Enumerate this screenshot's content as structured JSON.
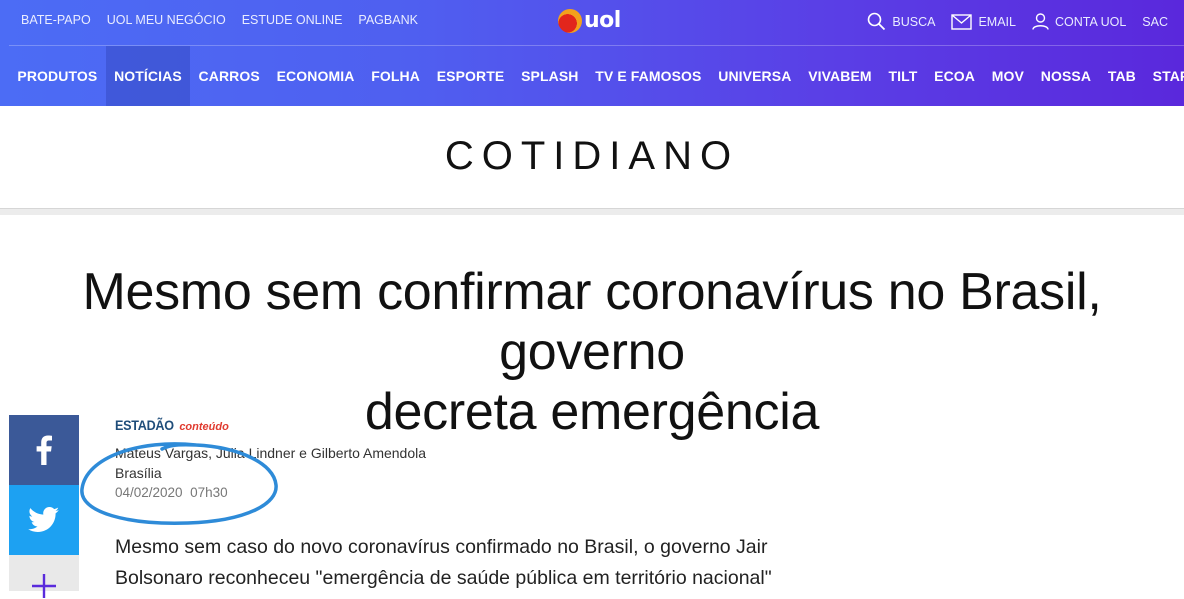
{
  "header": {
    "top_links": [
      "BATE-PAPO",
      "UOL MEU NEGÓCIO",
      "ESTUDE ONLINE",
      "PAGBANK"
    ],
    "logo_text": "uol",
    "right_links": {
      "search": "BUSCA",
      "email": "EMAIL",
      "account": "CONTA UOL",
      "sac": "SAC"
    },
    "nav": [
      "PRODUTOS",
      "NOTÍCIAS",
      "CARROS",
      "ECONOMIA",
      "FOLHA",
      "ESPORTE",
      "SPLASH",
      "TV E FAMOSOS",
      "UNIVERSA",
      "VIVABEM",
      "TILT",
      "ECOA",
      "MOV",
      "NOSSA",
      "TAB",
      "START"
    ],
    "active_nav": "NOTÍCIAS"
  },
  "section": {
    "title": "COTIDIANO"
  },
  "article": {
    "headline_line1": "Mesmo sem confirmar coronavírus no Brasil, governo",
    "headline_line2": "decreta emergência",
    "source_main": "ESTADÃO",
    "source_sub": "conteúdo",
    "authors": "Mateus Vargas, Julia Lindner e Gilberto Amendola",
    "place": "Brasília",
    "date": "04/02/2020",
    "time": "07h30",
    "body_line1": "Mesmo sem caso do novo coronavírus confirmado no Brasil, o governo Jair",
    "body_line2": "Bolsonaro reconheceu \"emergência de saúde pública em território nacional\""
  },
  "share": {
    "icons": [
      "facebook-icon",
      "twitter-icon",
      "plus-icon"
    ]
  },
  "colors": {
    "header_start": "#4c6cf5",
    "header_end": "#5a28dc",
    "facebook": "#3b5998",
    "twitter": "#1da1f2",
    "annotation_circle": "#2e8bd8"
  }
}
